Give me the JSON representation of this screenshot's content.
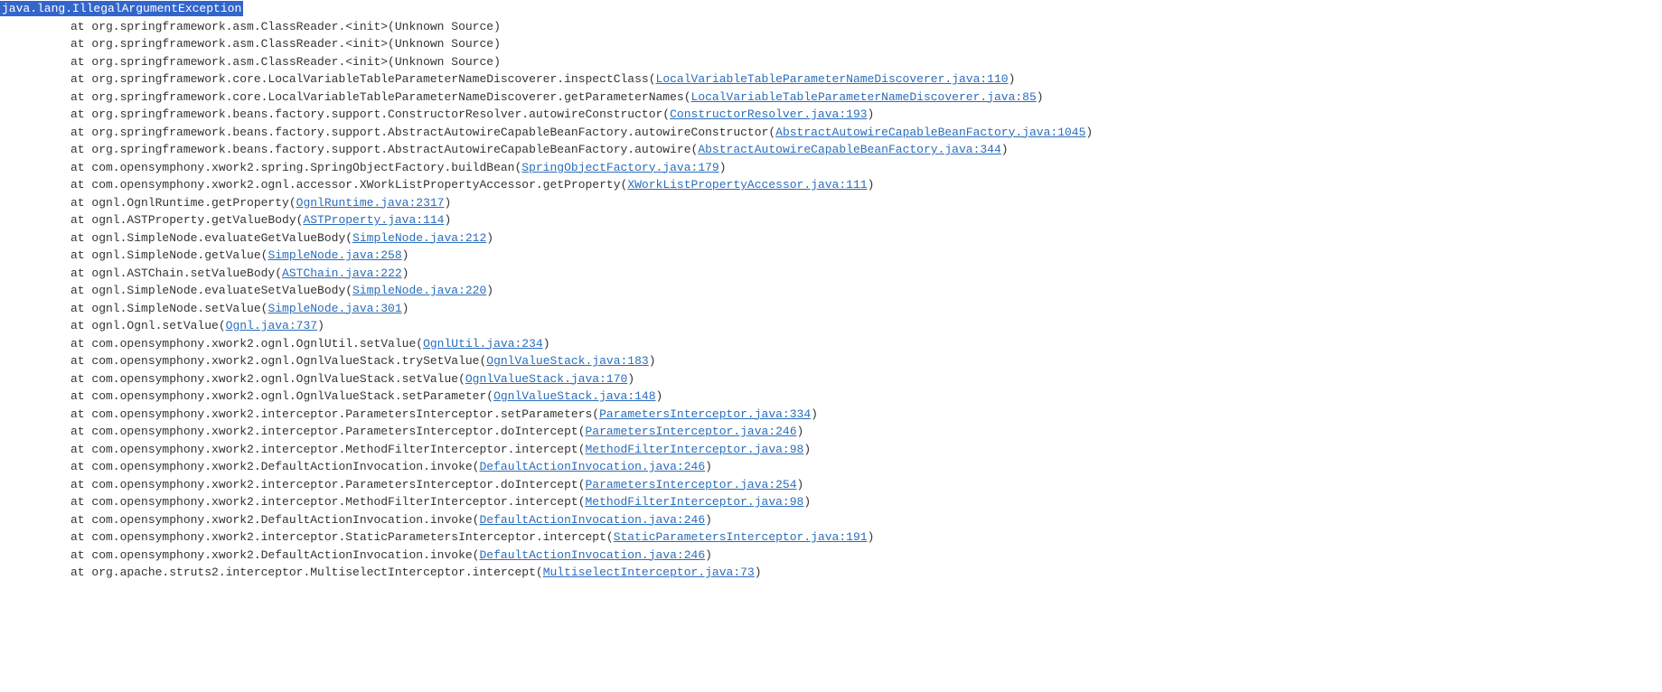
{
  "exception": "java.lang.IllegalArgumentException",
  "stack": [
    {
      "prefix": "at org.springframework.asm.ClassReader.<init>(Unknown Source)",
      "link": null
    },
    {
      "prefix": "at org.springframework.asm.ClassReader.<init>(Unknown Source)",
      "link": null
    },
    {
      "prefix": "at org.springframework.asm.ClassReader.<init>(Unknown Source)",
      "link": null
    },
    {
      "prefix": "at org.springframework.core.LocalVariableTableParameterNameDiscoverer.inspectClass(",
      "link": "LocalVariableTableParameterNameDiscoverer.java:110",
      "suffix": ")"
    },
    {
      "prefix": "at org.springframework.core.LocalVariableTableParameterNameDiscoverer.getParameterNames(",
      "link": "LocalVariableTableParameterNameDiscoverer.java:85",
      "suffix": ")"
    },
    {
      "prefix": "at org.springframework.beans.factory.support.ConstructorResolver.autowireConstructor(",
      "link": "ConstructorResolver.java:193",
      "suffix": ")"
    },
    {
      "prefix": "at org.springframework.beans.factory.support.AbstractAutowireCapableBeanFactory.autowireConstructor(",
      "link": "AbstractAutowireCapableBeanFactory.java:1045",
      "suffix": ")"
    },
    {
      "prefix": "at org.springframework.beans.factory.support.AbstractAutowireCapableBeanFactory.autowire(",
      "link": "AbstractAutowireCapableBeanFactory.java:344",
      "suffix": ")"
    },
    {
      "prefix": "at com.opensymphony.xwork2.spring.SpringObjectFactory.buildBean(",
      "link": "SpringObjectFactory.java:179",
      "suffix": ")"
    },
    {
      "prefix": "at com.opensymphony.xwork2.ognl.accessor.XWorkListPropertyAccessor.getProperty(",
      "link": "XWorkListPropertyAccessor.java:111",
      "suffix": ")"
    },
    {
      "prefix": "at ognl.OgnlRuntime.getProperty(",
      "link": "OgnlRuntime.java:2317",
      "suffix": ")"
    },
    {
      "prefix": "at ognl.ASTProperty.getValueBody(",
      "link": "ASTProperty.java:114",
      "suffix": ")"
    },
    {
      "prefix": "at ognl.SimpleNode.evaluateGetValueBody(",
      "link": "SimpleNode.java:212",
      "suffix": ")"
    },
    {
      "prefix": "at ognl.SimpleNode.getValue(",
      "link": "SimpleNode.java:258",
      "suffix": ")"
    },
    {
      "prefix": "at ognl.ASTChain.setValueBody(",
      "link": "ASTChain.java:222",
      "suffix": ")"
    },
    {
      "prefix": "at ognl.SimpleNode.evaluateSetValueBody(",
      "link": "SimpleNode.java:220",
      "suffix": ")"
    },
    {
      "prefix": "at ognl.SimpleNode.setValue(",
      "link": "SimpleNode.java:301",
      "suffix": ")"
    },
    {
      "prefix": "at ognl.Ognl.setValue(",
      "link": "Ognl.java:737",
      "suffix": ")"
    },
    {
      "prefix": "at com.opensymphony.xwork2.ognl.OgnlUtil.setValue(",
      "link": "OgnlUtil.java:234",
      "suffix": ")"
    },
    {
      "prefix": "at com.opensymphony.xwork2.ognl.OgnlValueStack.trySetValue(",
      "link": "OgnlValueStack.java:183",
      "suffix": ")"
    },
    {
      "prefix": "at com.opensymphony.xwork2.ognl.OgnlValueStack.setValue(",
      "link": "OgnlValueStack.java:170",
      "suffix": ")"
    },
    {
      "prefix": "at com.opensymphony.xwork2.ognl.OgnlValueStack.setParameter(",
      "link": "OgnlValueStack.java:148",
      "suffix": ")"
    },
    {
      "prefix": "at com.opensymphony.xwork2.interceptor.ParametersInterceptor.setParameters(",
      "link": "ParametersInterceptor.java:334",
      "suffix": ")"
    },
    {
      "prefix": "at com.opensymphony.xwork2.interceptor.ParametersInterceptor.doIntercept(",
      "link": "ParametersInterceptor.java:246",
      "suffix": ")"
    },
    {
      "prefix": "at com.opensymphony.xwork2.interceptor.MethodFilterInterceptor.intercept(",
      "link": "MethodFilterInterceptor.java:98",
      "suffix": ")"
    },
    {
      "prefix": "at com.opensymphony.xwork2.DefaultActionInvocation.invoke(",
      "link": "DefaultActionInvocation.java:246",
      "suffix": ")"
    },
    {
      "prefix": "at com.opensymphony.xwork2.interceptor.ParametersInterceptor.doIntercept(",
      "link": "ParametersInterceptor.java:254",
      "suffix": ")"
    },
    {
      "prefix": "at com.opensymphony.xwork2.interceptor.MethodFilterInterceptor.intercept(",
      "link": "MethodFilterInterceptor.java:98",
      "suffix": ")"
    },
    {
      "prefix": "at com.opensymphony.xwork2.DefaultActionInvocation.invoke(",
      "link": "DefaultActionInvocation.java:246",
      "suffix": ")"
    },
    {
      "prefix": "at com.opensymphony.xwork2.interceptor.StaticParametersInterceptor.intercept(",
      "link": "StaticParametersInterceptor.java:191",
      "suffix": ")"
    },
    {
      "prefix": "at com.opensymphony.xwork2.DefaultActionInvocation.invoke(",
      "link": "DefaultActionInvocation.java:246",
      "suffix": ")"
    },
    {
      "prefix": "at org.apache.struts2.interceptor.MultiselectInterceptor.intercept(",
      "link": "MultiselectInterceptor.java:73",
      "suffix": ")"
    }
  ]
}
